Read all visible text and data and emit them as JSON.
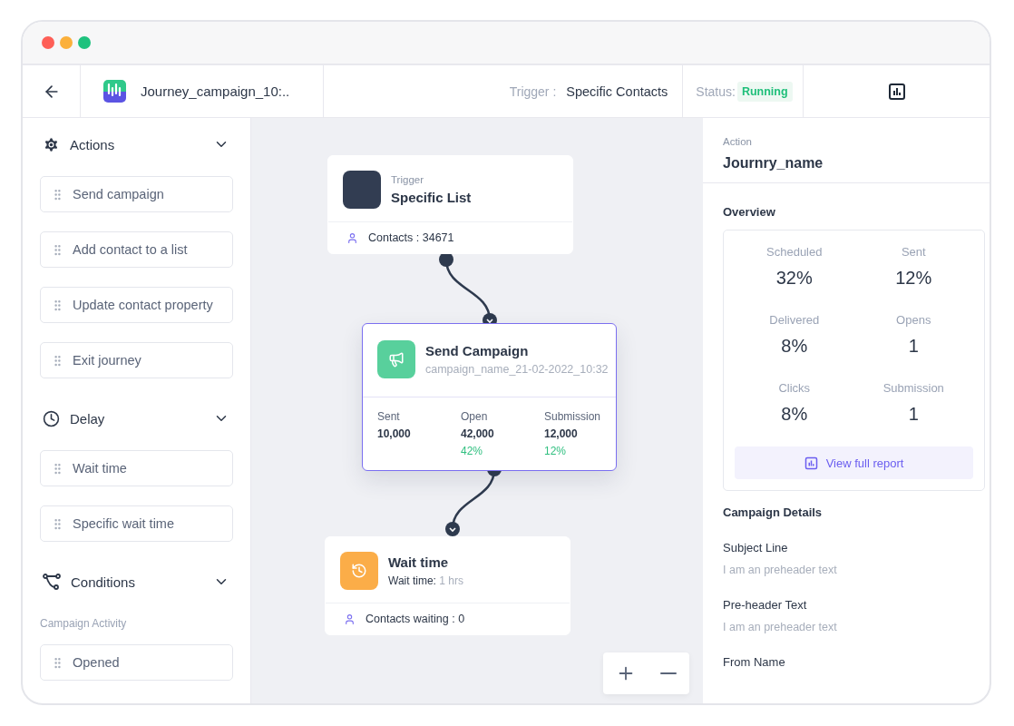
{
  "header": {
    "title": "Journey_campaign_10:..",
    "trigger_label": "Trigger :",
    "trigger_value": "Specific Contacts",
    "status_label": "Status:",
    "status": "Running"
  },
  "sidebar": {
    "sections": [
      {
        "kind": "actions",
        "title": "Actions",
        "expanded": true,
        "items": [
          "Send campaign",
          "Add contact to a list",
          "Update contact property",
          "Exit journey"
        ]
      },
      {
        "kind": "delay",
        "title": "Delay",
        "expanded": true,
        "items": [
          "Wait time",
          "Specific wait time"
        ]
      },
      {
        "kind": "conditions",
        "title": "Conditions",
        "expanded": true,
        "subheading": "Campaign Activity",
        "items": [
          "Opened"
        ]
      }
    ]
  },
  "canvas": {
    "nodes": [
      {
        "kind": "trigger",
        "label": "Trigger",
        "title": "Specific List",
        "footer": "Contacts : 34671",
        "selected": false
      },
      {
        "kind": "campaign",
        "title": "Send Campaign",
        "subtitle": "campaign_name_21-02-2022_10:32",
        "selected": true,
        "stats": [
          {
            "label": "Sent",
            "value": "10,000"
          },
          {
            "label": "Open",
            "value": "42,000",
            "rate": "42%"
          },
          {
            "label": "Submission",
            "value": "12,000",
            "rate": "12%"
          }
        ]
      },
      {
        "kind": "wait",
        "title": "Wait time",
        "detail_label": "Wait time:",
        "detail_value": "1 hrs",
        "footer": "Contacts waiting : 0",
        "selected": false
      }
    ]
  },
  "panel": {
    "label": "Action",
    "title": "Journry_name",
    "overview_title": "Overview",
    "metrics": [
      {
        "label": "Scheduled",
        "value": "32%"
      },
      {
        "label": "Sent",
        "value": "12%"
      },
      {
        "label": "Delivered",
        "value": "8%"
      },
      {
        "label": "Opens",
        "value": "1"
      },
      {
        "label": "Clicks",
        "value": "8%"
      },
      {
        "label": "Submission",
        "value": "1"
      }
    ],
    "report_button": "View full report",
    "details_title": "Campaign Details",
    "fields": [
      {
        "label": "Subject Line",
        "value": "I am an preheader text"
      },
      {
        "label": "Pre-header Text",
        "value": "I am an preheader text"
      },
      {
        "label": "From Name"
      }
    ]
  }
}
